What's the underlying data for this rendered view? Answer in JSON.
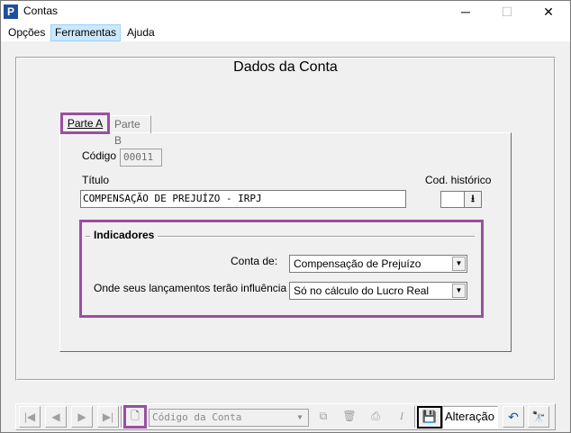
{
  "window": {
    "title": "Contas",
    "app_icon_letter": "P",
    "minimize": "─",
    "maximize": "☐",
    "close": "✕"
  },
  "menu": {
    "items": [
      "Opções",
      "Ferramentas",
      "Ajuda"
    ],
    "active": "Ferramentas"
  },
  "page": {
    "title": "Dados da Conta"
  },
  "tabs": [
    {
      "label": "Parte A",
      "selected": true
    },
    {
      "label": "Parte B",
      "selected": false
    }
  ],
  "form": {
    "codigo_label": "Código",
    "codigo_value": "00011",
    "titulo_label": "Título",
    "titulo_value": "COMPENSAÇÃO DE PREJUÍZO - IRPJ",
    "cod_historico_label": "Cod. histórico",
    "cod_historico_value": "",
    "lookup_icon": "⭳"
  },
  "indicadores": {
    "title": "Indicadores",
    "conta_de_label": "Conta de:",
    "conta_de_value": "Compensação de Prejuízo",
    "influencia_label": "Onde seus lançamentos terão influência ?",
    "influencia_value": "Só no cálculo do Lucro Real"
  },
  "toolbar": {
    "first_icon": "|◀",
    "prev_icon": "◀",
    "next_icon": "▶",
    "last_icon": "▶|",
    "new_icon": "🗋",
    "search_placeholder": "Código da Conta",
    "search_arrow": "▼",
    "copy_icon": "⧉",
    "delete_icon": "🗑",
    "print_icon": "⎙",
    "italic_icon": "I",
    "save_icon": "💾",
    "status_text": "Alteração",
    "undo_icon": "↶",
    "find_icon": "🔭"
  },
  "colors": {
    "highlight": "#9b4f9f",
    "background": "#f0f0f0",
    "menu_active": "#cce8ff"
  }
}
